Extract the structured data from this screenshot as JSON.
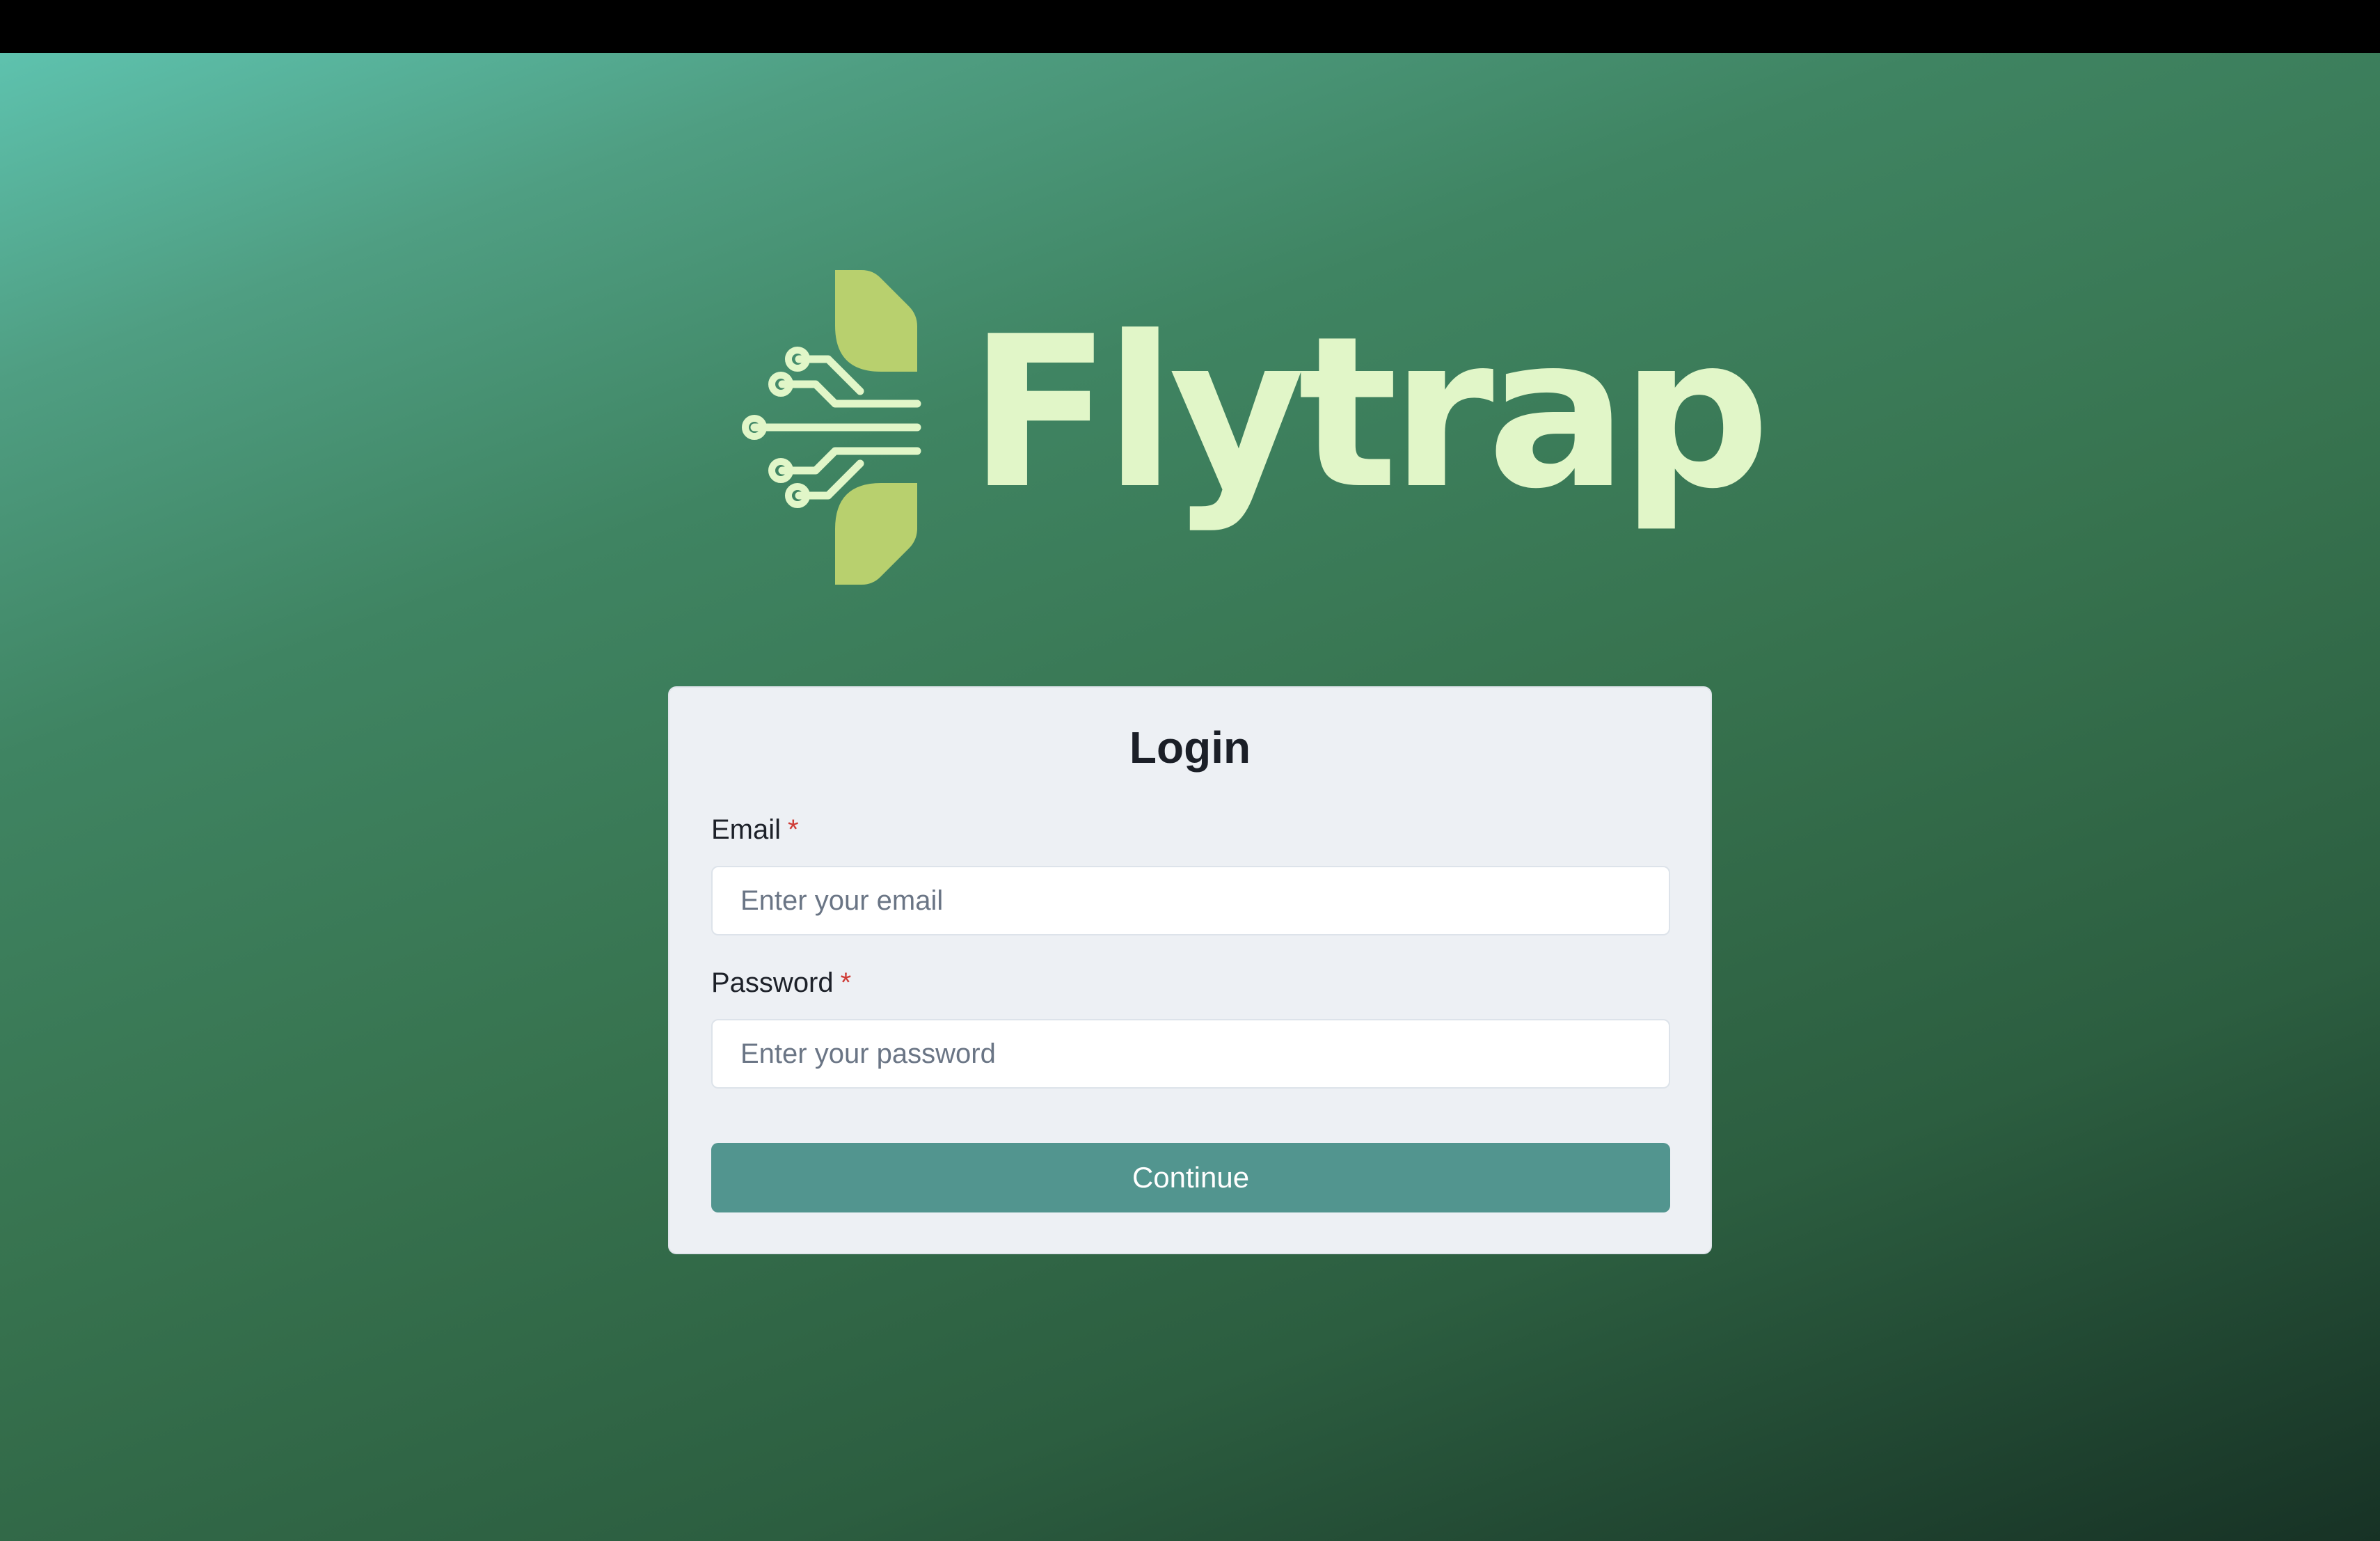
{
  "brand": {
    "name": "Flytrap",
    "logo_icon": "circuit-leaf-icon",
    "colors": {
      "wordmark": "#e1f6c8",
      "leaf": "#b8d06e",
      "background_top": "#5ec2ae",
      "background_bottom": "#173225"
    }
  },
  "login": {
    "title": "Login",
    "email": {
      "label": "Email",
      "required_mark": "*",
      "placeholder": "Enter your email",
      "value": ""
    },
    "password": {
      "label": "Password",
      "required_mark": "*",
      "placeholder": "Enter your password",
      "value": ""
    },
    "submit_label": "Continue",
    "colors": {
      "button": "#52958f",
      "required": "#cf3b35",
      "card": "#edf0f4"
    }
  }
}
